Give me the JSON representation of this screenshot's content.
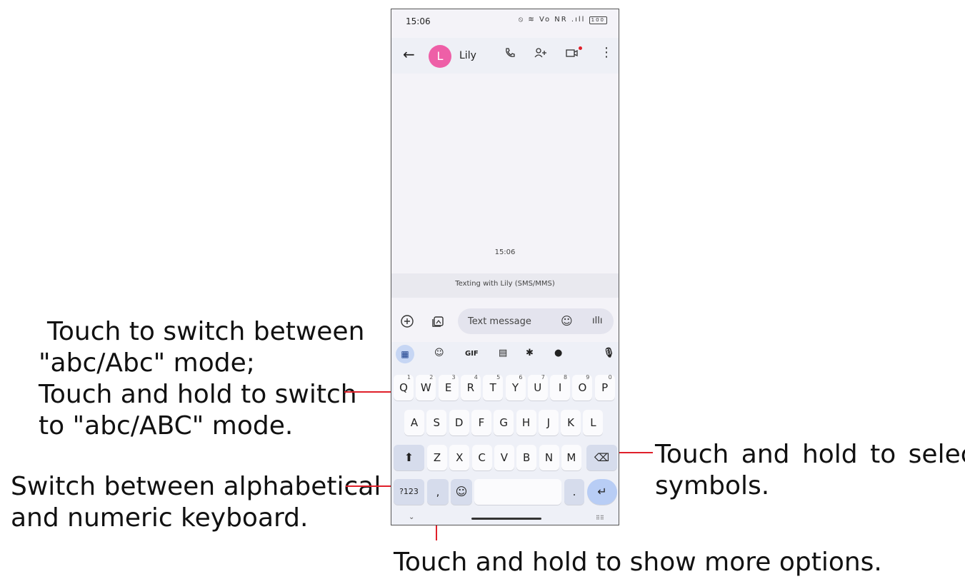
{
  "status_bar": {
    "time": "15:06",
    "icons": "⦸ ≋ Vo NR .ıll",
    "battery": "100"
  },
  "app_bar": {
    "back_icon": "arrow-left",
    "avatar_letter": "L",
    "contact_name": "Lily",
    "icons": [
      "phone-icon",
      "add-person-icon",
      "video-icon",
      "more-vert-icon"
    ]
  },
  "conversation": {
    "timestamp": "15:06",
    "banner": "Texting with Lily (SMS/MMS)"
  },
  "composer": {
    "placeholder": "Text message"
  },
  "keyboard": {
    "row1": [
      [
        "Q",
        "1"
      ],
      [
        "W",
        "2"
      ],
      [
        "E",
        "3"
      ],
      [
        "R",
        "4"
      ],
      [
        "T",
        "5"
      ],
      [
        "Y",
        "6"
      ],
      [
        "U",
        "7"
      ],
      [
        "I",
        "8"
      ],
      [
        "O",
        "9"
      ],
      [
        "P",
        "0"
      ]
    ],
    "row2": [
      "A",
      "S",
      "D",
      "F",
      "G",
      "H",
      "J",
      "K",
      "L"
    ],
    "row3": [
      "Z",
      "X",
      "C",
      "V",
      "B",
      "N",
      "M"
    ],
    "toolbar_gif": "GIF",
    "symbols_key": "?123",
    "comma": ",",
    "period": "."
  },
  "annotations": {
    "shift": [
      "Touch to switch between",
      "\"abc/Abc\" mode;",
      "Touch and hold to switch",
      "to \"abc/ABC\" mode."
    ],
    "symbols": [
      "Switch between alphabetical",
      "and numeric keyboard."
    ],
    "period": [
      "Touch and hold to select",
      "symbols."
    ],
    "comma": "Touch and hold to show more options."
  },
  "colors": {
    "annotation_line": "#e0202a",
    "avatar": "#ee5fa7",
    "accent_key": "#c6d6f4"
  }
}
